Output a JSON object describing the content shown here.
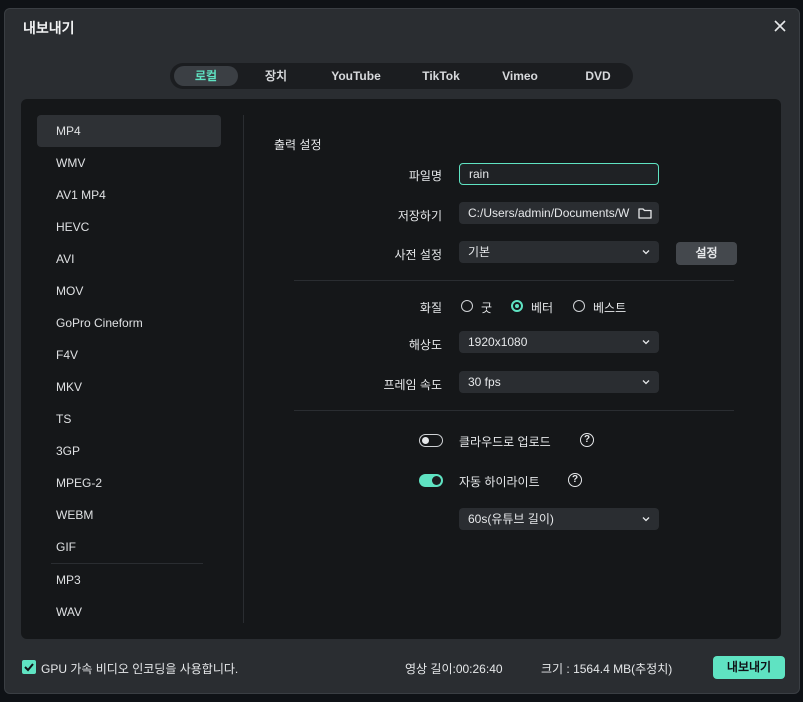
{
  "dialog": {
    "title": "내보내기"
  },
  "tabs": [
    "로컬",
    "장치",
    "YouTube",
    "TikTok",
    "Vimeo",
    "DVD"
  ],
  "formats": [
    "MP4",
    "WMV",
    "AV1 MP4",
    "HEVC",
    "AVI",
    "MOV",
    "GoPro Cineform",
    "F4V",
    "MKV",
    "TS",
    "3GP",
    "MPEG-2",
    "WEBM",
    "GIF",
    "MP3",
    "WAV"
  ],
  "selected_format": "MP4",
  "output": {
    "section_title": "출력 설정",
    "filename_label": "파일명",
    "filename_value": "rain",
    "save_label": "저장하기",
    "save_path": "C:/Users/admin/Documents/W",
    "preset_label": "사전 설정",
    "preset_value": "기본",
    "settings_button": "설정",
    "quality_label": "화질",
    "quality_options": [
      "굿",
      "베터",
      "베스트"
    ],
    "quality_selected": "베터",
    "resolution_label": "해상도",
    "resolution_value": "1920x1080",
    "framerate_label": "프레임 속도",
    "framerate_value": "30 fps",
    "cloud_upload_label": "클라우드로 업로드",
    "cloud_upload_enabled": false,
    "auto_highlight_label": "자동 하이라이트",
    "auto_highlight_enabled": true,
    "highlight_length_value": "60s(유튜브 길이)"
  },
  "footer": {
    "gpu_label": "GPU 가속 비디오 인코딩을 사용합니다.",
    "gpu_enabled": true,
    "duration": "영상 길이:00:26:40",
    "size": "크기 : 1564.4 MB(추정치)",
    "export_button": "내보내기"
  },
  "colors": {
    "accent": "#5fe3c2",
    "panel": "#151719",
    "dialog": "#2a2d31"
  }
}
